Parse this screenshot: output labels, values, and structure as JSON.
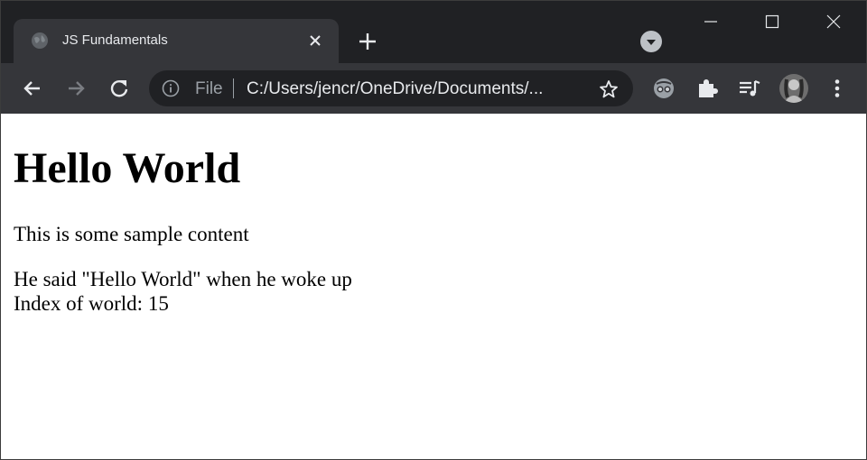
{
  "browser": {
    "tab": {
      "title": "JS Fundamentals",
      "favicon": "globe-icon"
    },
    "address_bar": {
      "scheme_label": "File",
      "url": "C:/Users/jencr/OneDrive/Documents/...",
      "info_icon": "info-icon",
      "bookmark_icon": "star-icon"
    },
    "toolbar_icons": [
      "back-arrow-icon",
      "forward-arrow-icon",
      "reload-icon",
      "extension-glasses-icon",
      "extensions-puzzle-icon",
      "media-queue-icon",
      "profile-avatar",
      "menu-dots-icon"
    ],
    "window_controls": [
      "minimize-icon",
      "maximize-icon",
      "close-icon"
    ]
  },
  "page": {
    "heading": "Hello World",
    "paragraph": "This is some sample content",
    "quote_line": "He said \"Hello World\" when he woke up",
    "index_line": "Index of world: 15"
  },
  "colors": {
    "frame": "#202124",
    "toolbar": "#35363a",
    "text_light": "#e8eaed",
    "text_dim": "#9aa0a6",
    "page_bg": "#ffffff"
  }
}
